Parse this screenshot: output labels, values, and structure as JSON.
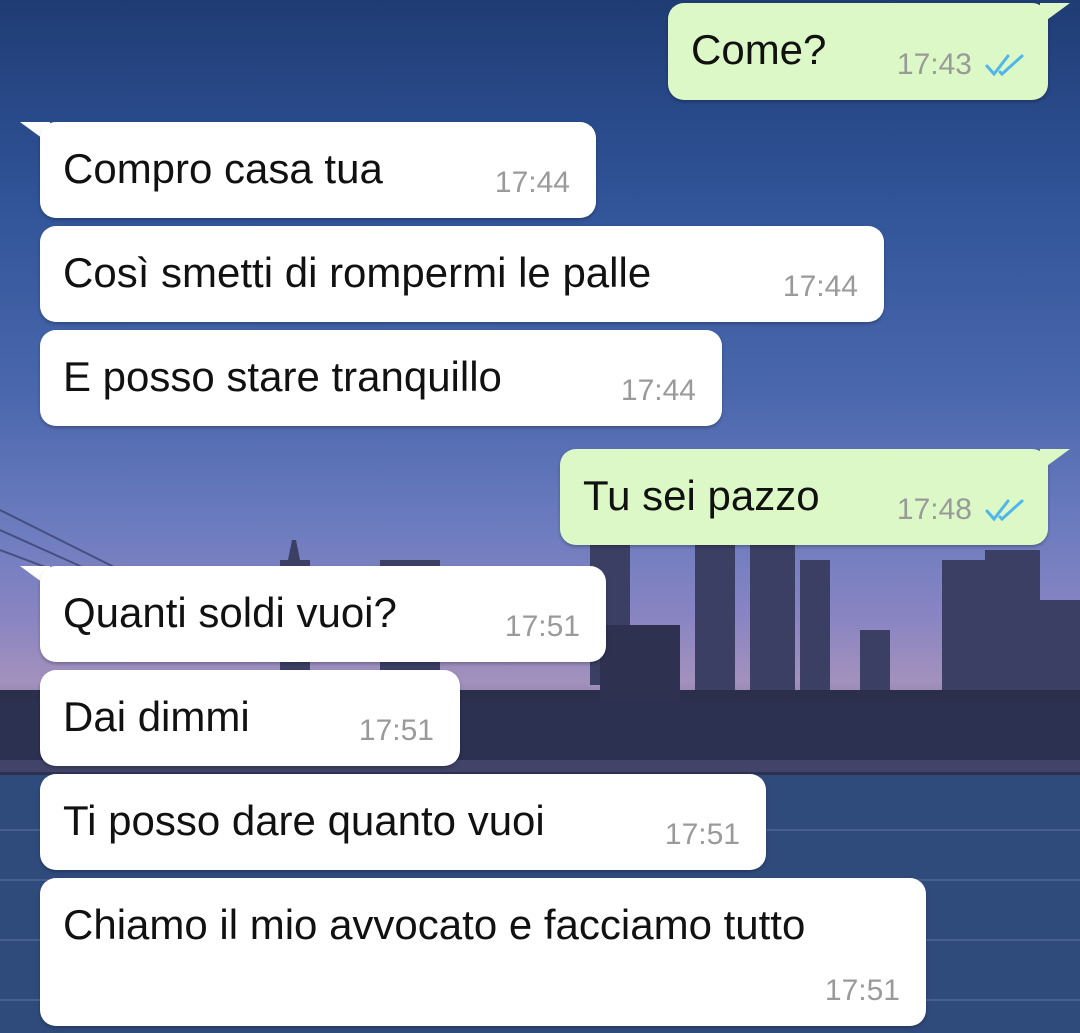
{
  "chat": {
    "messages": [
      {
        "direction": "out",
        "text": "Come?",
        "time": "17:43",
        "status": "read"
      },
      {
        "direction": "in",
        "text": "Compro casa tua",
        "time": "17:44"
      },
      {
        "direction": "in",
        "text": "Così smetti di rompermi le palle",
        "time": "17:44"
      },
      {
        "direction": "in",
        "text": "E posso stare tranquillo",
        "time": "17:44"
      },
      {
        "direction": "out",
        "text": "Tu sei pazzo",
        "time": "17:48",
        "status": "read"
      },
      {
        "direction": "in",
        "text": "Quanti soldi vuoi?",
        "time": "17:51"
      },
      {
        "direction": "in",
        "text": "Dai dimmi",
        "time": "17:51"
      },
      {
        "direction": "in",
        "text": "Ti posso dare quanto vuoi",
        "time": "17:51"
      },
      {
        "direction": "in",
        "text": "Chiamo il mio avvocato e facciamo tutto",
        "time": "17:51"
      }
    ]
  },
  "colors": {
    "incoming_bubble": "#ffffff",
    "outgoing_bubble": "#dcf8c6",
    "read_ticks": "#4fb6ec",
    "timestamp": "#9a9a9a"
  },
  "icons": {
    "read_receipt": "double-check-icon",
    "wallpaper": "city-skyline-wallpaper"
  }
}
